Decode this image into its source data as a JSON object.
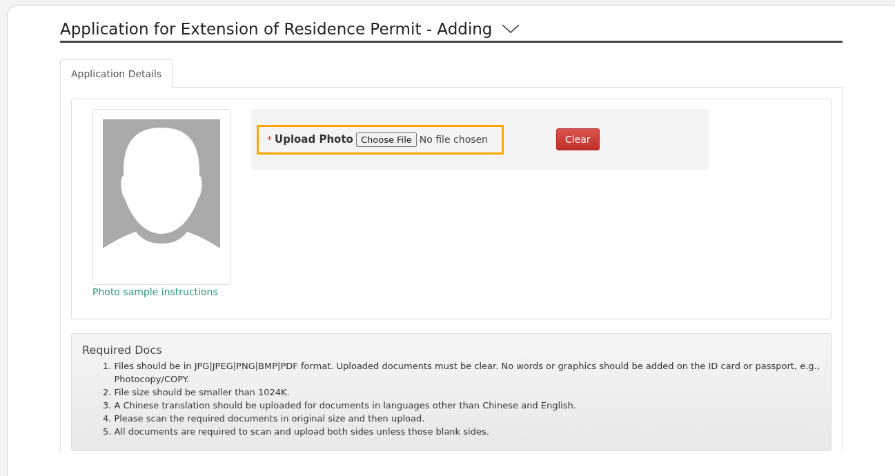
{
  "page": {
    "title": "Application for Extension of Residence Permit - Adding"
  },
  "tabs": [
    {
      "label": "Application Details",
      "selected": true
    }
  ],
  "photo": {
    "link": "Photo sample instructions"
  },
  "upload": {
    "required_mark": "*",
    "label": "Upload Photo",
    "button": "Choose File",
    "status": "No file chosen",
    "highlighted": true
  },
  "clear_button": "Clear",
  "required_docs": {
    "title": "Required Docs",
    "items": [
      {
        "number": "1.",
        "text": "Files should be in JPG|JPEG|PNG|BMP|PDF format. Uploaded documents must be clear. No words or graphics should be added on the ID card or passport, e.g., Photocopy/COPY."
      },
      {
        "number": "2.",
        "text": "File size should be smaller than 1024K."
      },
      {
        "number": "3.",
        "text": "A Chinese translation should be uploaded for documents in languages other than Chinese and English."
      },
      {
        "number": "4.",
        "text": "Please scan the required documents in original size and then upload."
      },
      {
        "number": "5.",
        "text": "All documents are required to scan and upload both sides unless those blank sides."
      }
    ]
  }
}
